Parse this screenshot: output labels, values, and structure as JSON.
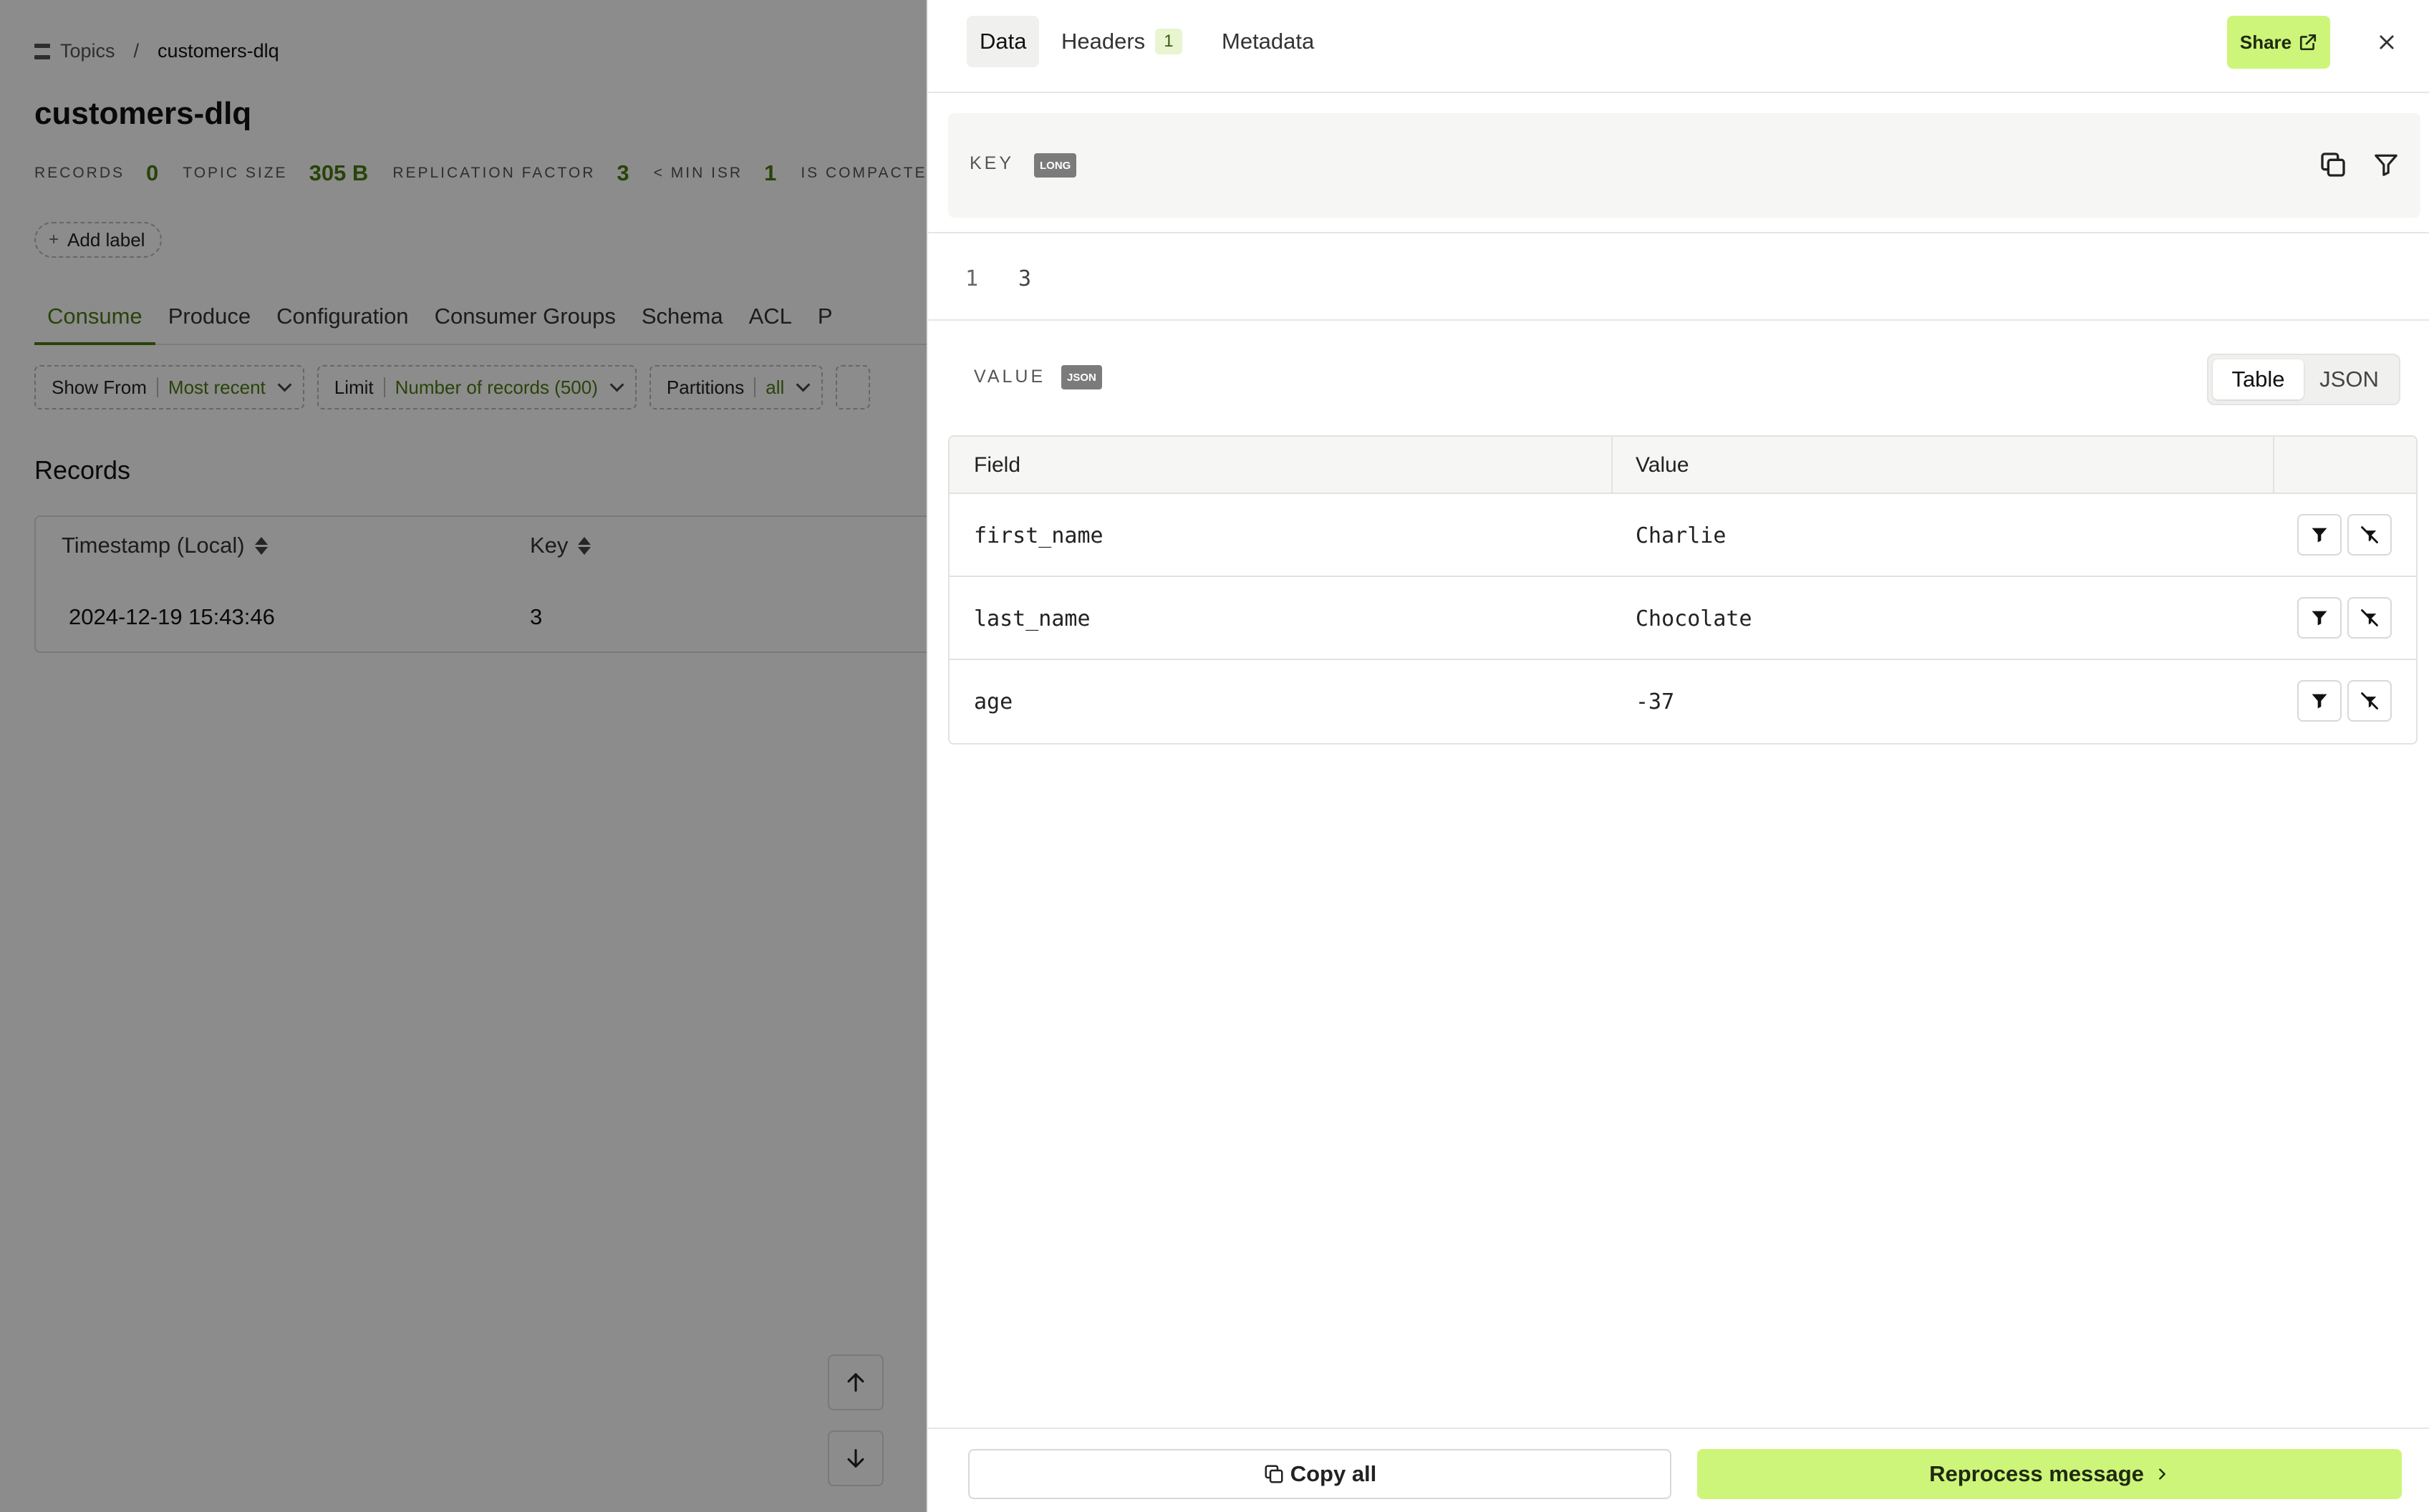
{
  "breadcrumb": {
    "topics_label": "Topics",
    "current": "customers-dlq"
  },
  "topic": {
    "title": "customers-dlq"
  },
  "stats": [
    {
      "label": "RECORDS",
      "value": "0"
    },
    {
      "label": "TOPIC SIZE",
      "value": "305 B"
    },
    {
      "label": "REPLICATION FACTOR",
      "value": "3"
    },
    {
      "label": "< MIN ISR",
      "value": "1"
    },
    {
      "label": "IS COMPACTED",
      "value": ""
    }
  ],
  "add_label": "Add label",
  "tabs": [
    "Consume",
    "Produce",
    "Configuration",
    "Consumer Groups",
    "Schema",
    "ACL",
    "P"
  ],
  "filters": [
    {
      "label": "Show From",
      "value": "Most recent"
    },
    {
      "label": "Limit",
      "value": "Number of records (500)"
    },
    {
      "label": "Partitions",
      "value": "all"
    }
  ],
  "records": {
    "title": "Records",
    "columns": [
      "Timestamp (Local)",
      "Key"
    ],
    "rows": [
      {
        "timestamp": "2024-12-19 15:43:46",
        "key": "3"
      }
    ]
  },
  "drawer": {
    "tabs": [
      {
        "label": "Data"
      },
      {
        "label": "Headers",
        "count": "1"
      },
      {
        "label": "Metadata"
      }
    ],
    "share_label": "Share",
    "key": {
      "label": "KEY",
      "type": "LONG",
      "lines": [
        {
          "num": "1",
          "text": "3"
        }
      ]
    },
    "value": {
      "label": "VALUE",
      "type": "JSON",
      "view_options": [
        "Table",
        "JSON"
      ],
      "selected_view": "Table",
      "columns": [
        "Field",
        "Value"
      ],
      "rows": [
        {
          "field": "first_name",
          "value": "Charlie"
        },
        {
          "field": "last_name",
          "value": "Chocolate"
        },
        {
          "field": "age",
          "value": "-37"
        }
      ]
    },
    "footer": {
      "copy_all": "Copy all",
      "reprocess": "Reprocess message"
    }
  },
  "colors": {
    "accent": "#4b7a12",
    "primary_button": "#cdf57a"
  }
}
